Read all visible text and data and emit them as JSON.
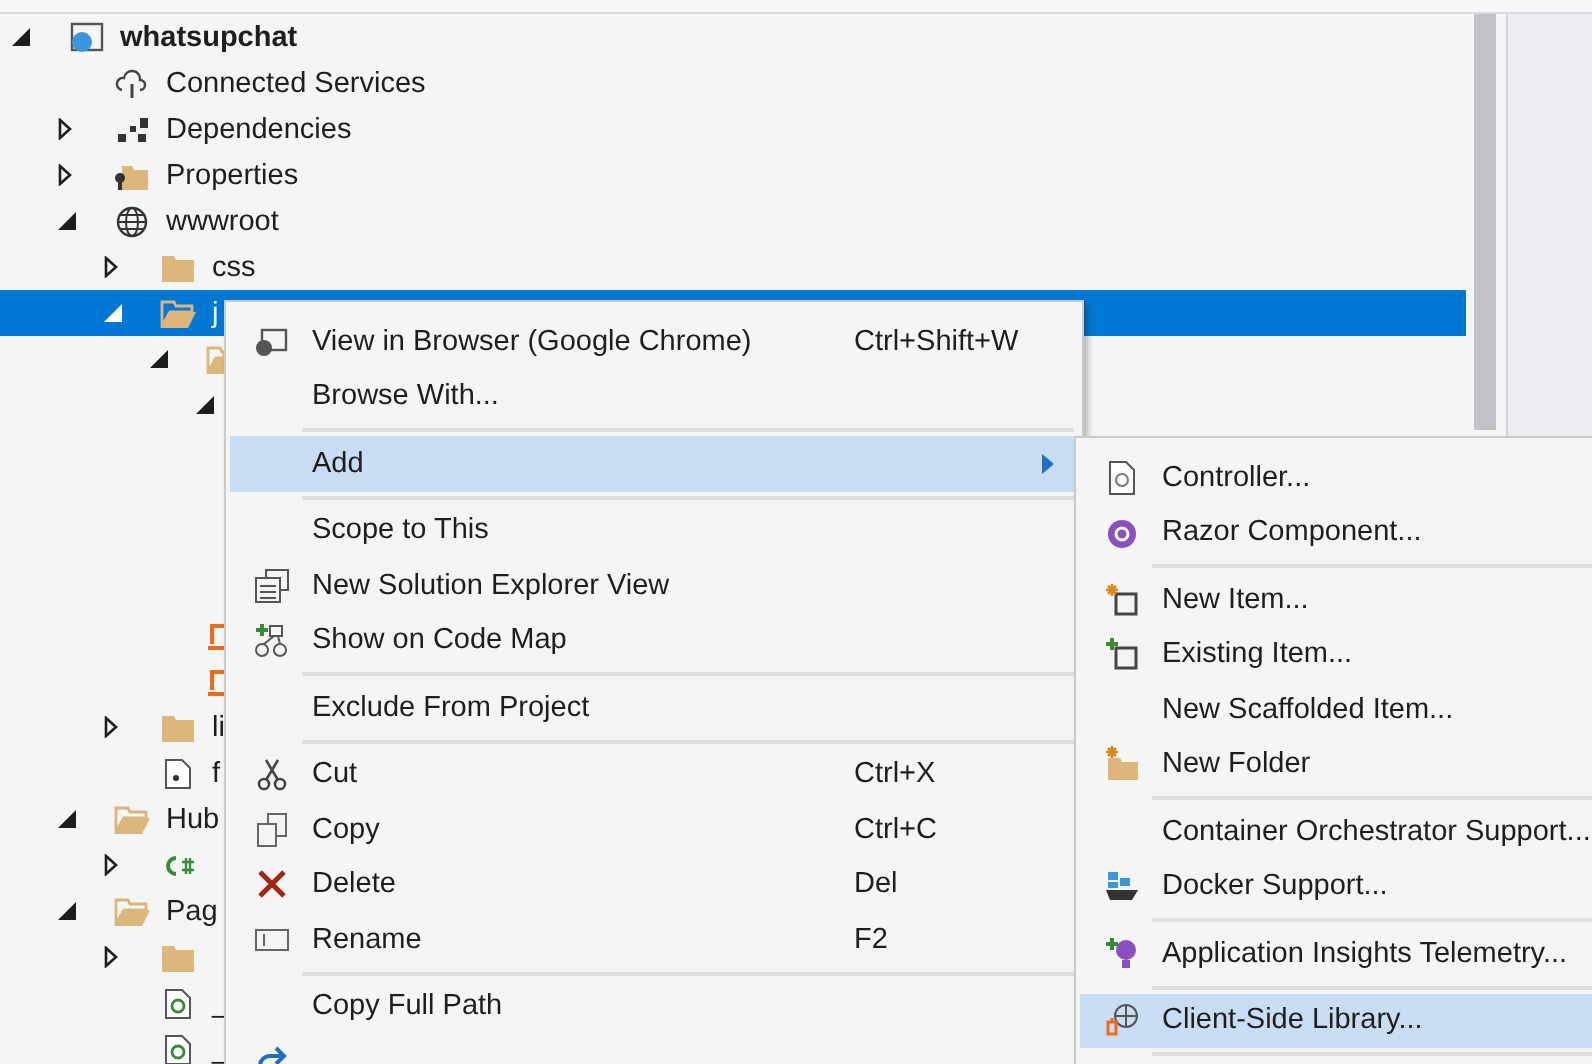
{
  "tree": [
    {
      "label": "whatsupchat",
      "kind": "project",
      "expanded": true,
      "selected": false,
      "children": [
        {
          "label": "Connected Services",
          "kind": "cloud",
          "selected": false
        },
        {
          "label": "Dependencies",
          "kind": "deps",
          "expanded": false,
          "selected": false
        },
        {
          "label": "Properties",
          "kind": "props",
          "expanded": false,
          "selected": false
        },
        {
          "label": "wwwroot",
          "kind": "globe",
          "expanded": true,
          "selected": false,
          "children": [
            {
              "label": "css",
              "kind": "folder",
              "expanded": false,
              "selected": false
            },
            {
              "label": "j",
              "kind": "folder-open",
              "expanded": true,
              "selected": true,
              "children": [
                {
                  "kind": "folder-open-part",
                  "expanded": true,
                  "selected": false,
                  "children": [
                    {
                      "expanded": true,
                      "selected": false
                    }
                  ]
                },
                {
                  "kind": "lib-file",
                  "selected": false
                },
                {
                  "kind": "lib-file",
                  "selected": false
                }
              ]
            },
            {
              "label": "li",
              "kind": "folder",
              "expanded": false,
              "selected": false
            },
            {
              "label": "f",
              "kind": "star-file",
              "selected": false
            }
          ]
        },
        {
          "label": "Hub",
          "kind": "folder-open",
          "expanded": true,
          "selected": false,
          "children": [
            {
              "kind": "csharp",
              "expanded": false,
              "selected": false
            }
          ]
        },
        {
          "label": "Pag",
          "kind": "folder-open",
          "expanded": true,
          "selected": false,
          "children": [
            {
              "kind": "folder",
              "expanded": false,
              "selected": false
            },
            {
              "label": "_",
              "kind": "razor-file",
              "selected": false
            },
            {
              "label": "_",
              "kind": "razor-file",
              "selected": false
            }
          ]
        }
      ]
    }
  ],
  "context_menu": [
    {
      "kind": "browser",
      "label": "View in Browser (Google Chrome)",
      "shortcut": "Ctrl+Shift+W",
      "selected": false
    },
    {
      "kind": "plain",
      "label": "Browse With...",
      "selected": false
    },
    {
      "kind": "separator"
    },
    {
      "kind": "plain",
      "label": "Add",
      "submenu": true,
      "selected": true
    },
    {
      "kind": "separator"
    },
    {
      "kind": "plain",
      "label": "Scope to This",
      "selected": false
    },
    {
      "kind": "solution-view",
      "label": "New Solution Explorer View",
      "selected": false
    },
    {
      "kind": "code-map",
      "label": "Show on Code Map",
      "selected": false
    },
    {
      "kind": "separator"
    },
    {
      "kind": "plain",
      "label": "Exclude From Project",
      "selected": false
    },
    {
      "kind": "separator"
    },
    {
      "kind": "cut",
      "label": "Cut",
      "shortcut": "Ctrl+X",
      "selected": false
    },
    {
      "kind": "copy",
      "label": "Copy",
      "shortcut": "Ctrl+C",
      "selected": false
    },
    {
      "kind": "delete",
      "label": "Delete",
      "shortcut": "Del",
      "selected": false
    },
    {
      "kind": "rename",
      "label": "Rename",
      "shortcut": "F2",
      "selected": false
    },
    {
      "kind": "separator"
    },
    {
      "kind": "plain",
      "label": "Copy Full Path",
      "selected": false
    },
    {
      "kind": "open-folder",
      "selected": false
    }
  ],
  "add_submenu": [
    {
      "kind": "controller",
      "label": "Controller...",
      "selected": false
    },
    {
      "kind": "razor",
      "label": "Razor Component...",
      "selected": false
    },
    {
      "kind": "separator"
    },
    {
      "kind": "new-item",
      "label": "New Item...",
      "selected": false
    },
    {
      "kind": "existing-item",
      "label": "Existing Item...",
      "selected": false
    },
    {
      "kind": "plain",
      "label": "New Scaffolded Item...",
      "selected": false
    },
    {
      "kind": "new-folder",
      "label": "New Folder",
      "selected": false
    },
    {
      "kind": "separator"
    },
    {
      "kind": "plain",
      "label": "Container Orchestrator Support...",
      "selected": false
    },
    {
      "kind": "docker",
      "label": "Docker Support...",
      "selected": false
    },
    {
      "kind": "separator"
    },
    {
      "kind": "insights",
      "label": "Application Insights Telemetry...",
      "selected": false
    },
    {
      "kind": "separator"
    },
    {
      "kind": "client-library",
      "label": "Client-Side Library...",
      "selected": true
    },
    {
      "kind": "separator"
    }
  ]
}
